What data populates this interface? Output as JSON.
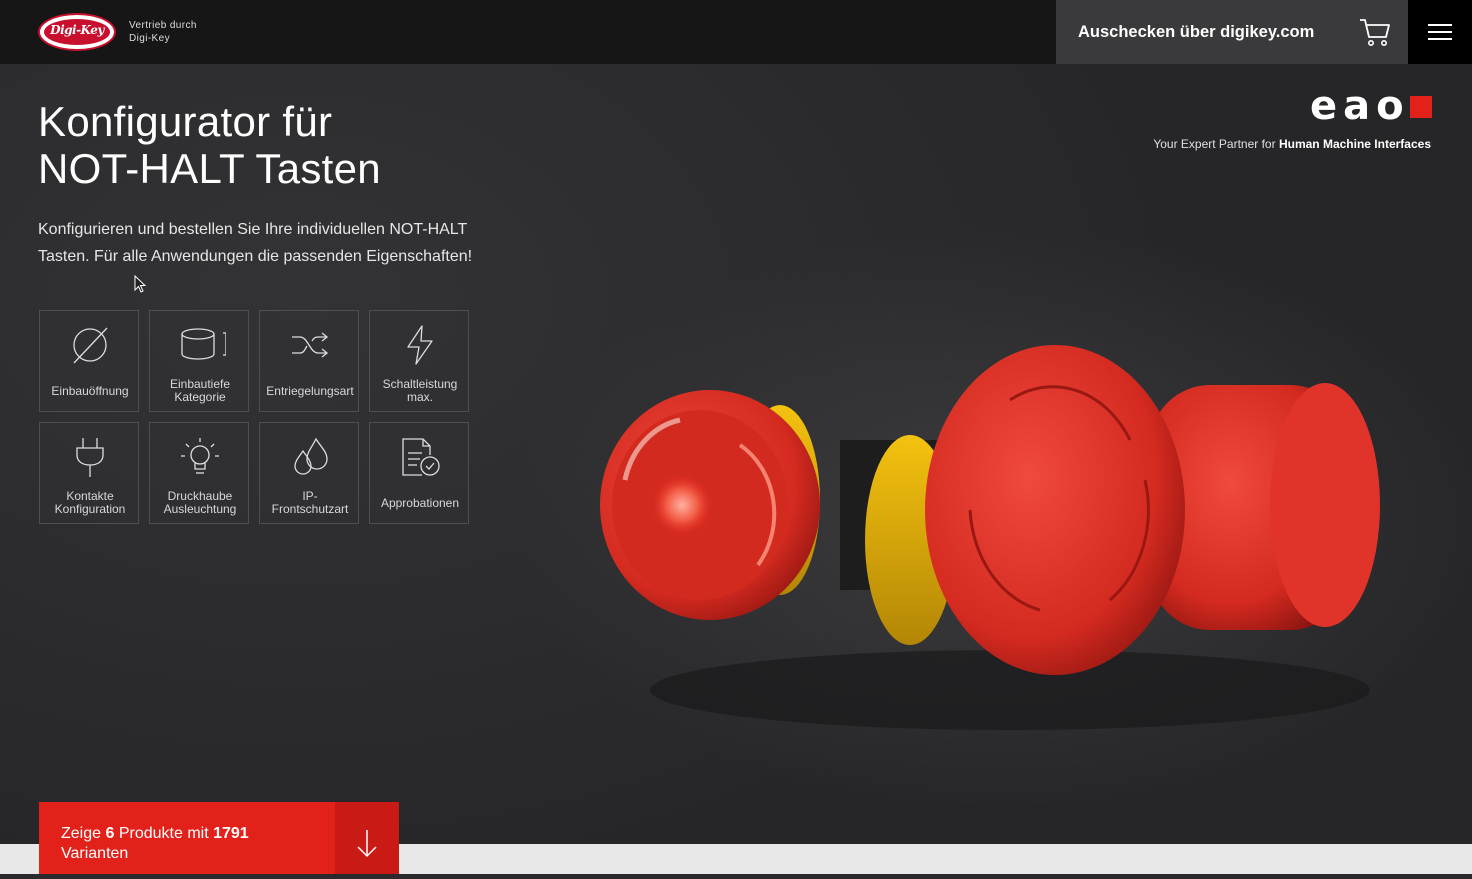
{
  "header": {
    "logo_alt": "Digi-Key",
    "logo_text": "Digi-Key",
    "vertrieb_line1": "Vertrieb durch",
    "vertrieb_line2": "Digi-Key",
    "checkout_label": "Auschecken über digikey.com"
  },
  "hero": {
    "title_line1": "Konfigurator für",
    "title_line2": "NOT-HALT Tasten",
    "intro_line1": "Konfigurieren und bestellen Sie Ihre individuellen NOT-HALT",
    "intro_line2": "Tasten. Für alle Anwendungen die passenden Eigenschaften!"
  },
  "brand": {
    "logo": "eao",
    "tagline_prefix": "Your Expert Partner for",
    "tagline_bold": "Human Machine Interfaces",
    "accent": "#e3211b"
  },
  "filters": [
    {
      "icon": "diameter-icon",
      "line1": "Einbauöffnung",
      "line2": ""
    },
    {
      "icon": "cylinder-depth-icon",
      "line1": "Einbautiefe",
      "line2": "Kategorie"
    },
    {
      "icon": "shuffle-icon",
      "line1": "Entriegelungsart",
      "line2": ""
    },
    {
      "icon": "lightning-icon",
      "line1": "Schaltleistung",
      "line2": "max."
    },
    {
      "icon": "plug-icon",
      "line1": "Kontakte",
      "line2": "Konfiguration"
    },
    {
      "icon": "bulb-icon",
      "line1": "Druckhaube",
      "line2": "Ausleuchtung"
    },
    {
      "icon": "water-drops-icon",
      "line1": "IP-",
      "line2": "Frontschutzart"
    },
    {
      "icon": "certificate-icon",
      "line1": "Approbationen",
      "line2": ""
    }
  ],
  "result": {
    "prefix": "Zeige",
    "count": "6",
    "middle": "Produkte mit",
    "variants": "1791",
    "suffix": "Varianten"
  }
}
